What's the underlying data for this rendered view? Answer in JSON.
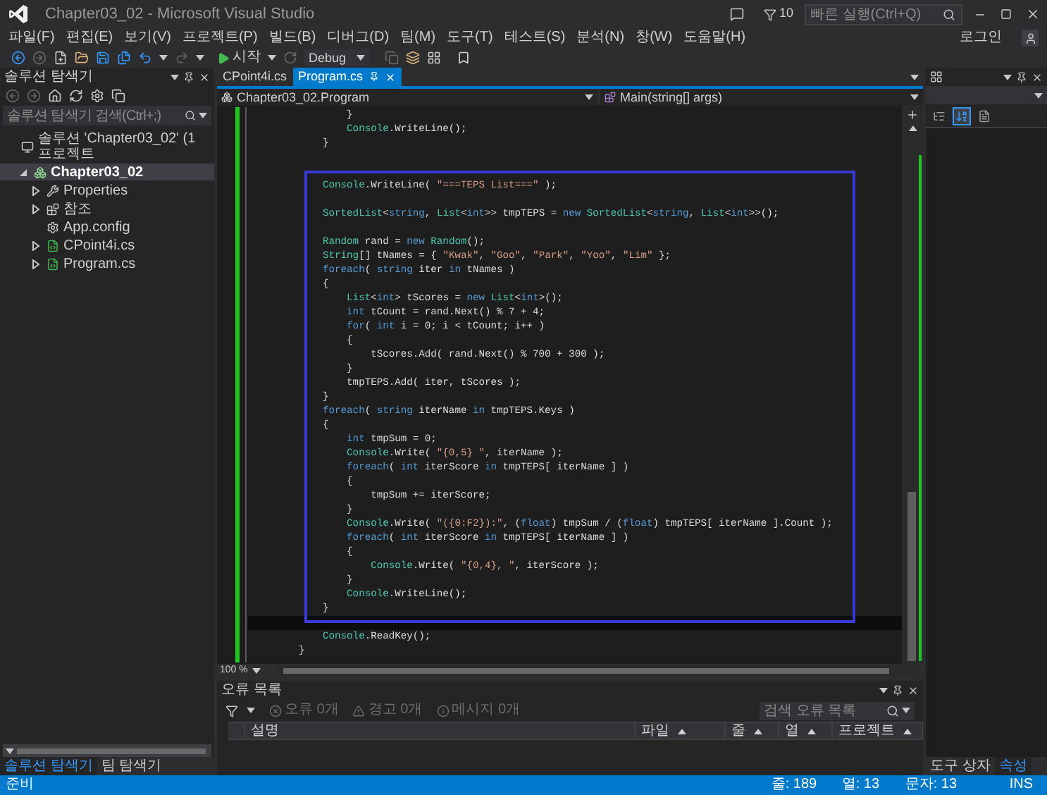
{
  "window": {
    "title": "Chapter03_02 - Microsoft Visual Studio"
  },
  "title_bar": {
    "notification_count": "10",
    "quick_launch": {
      "placeholder": "빠른 실행(Ctrl+Q)"
    }
  },
  "menu": [
    "파일(F)",
    "편집(E)",
    "보기(V)",
    "프로젝트(P)",
    "빌드(B)",
    "디버그(D)",
    "팀(M)",
    "도구(T)",
    "테스트(S)",
    "분석(N)",
    "창(W)",
    "도움말(H)"
  ],
  "account": {
    "label": "로그인"
  },
  "toolbar": {
    "start_label": "시작",
    "configuration": "Debug"
  },
  "solution_explorer": {
    "title": "솔루션 탐색기",
    "search": {
      "placeholder": "솔루션 탐색기 검색(Ctrl+;)"
    },
    "tree": [
      {
        "label": "솔루션 'Chapter03_02' (1 프로젝트",
        "kind": "solution",
        "selected": false,
        "children": [
          {
            "label": "Chapter03_02",
            "kind": "project",
            "expanded": true,
            "selected": true,
            "children": [
              {
                "label": "Properties",
                "kind": "properties",
                "expanded": false,
                "selected": false
              },
              {
                "label": "참조",
                "kind": "references",
                "expanded": false,
                "selected": false
              },
              {
                "label": "App.config",
                "kind": "config",
                "selected": false
              },
              {
                "label": "CPoint4i.cs",
                "kind": "csharp",
                "expanded": false,
                "selected": false
              },
              {
                "label": "Program.cs",
                "kind": "csharp",
                "expanded": false,
                "selected": false
              }
            ]
          }
        ]
      }
    ],
    "bottom_tabs": [
      {
        "label": "솔루션 탐색기",
        "selected": true
      },
      {
        "label": "팀 탐색기",
        "selected": false
      }
    ]
  },
  "editor": {
    "tabs": [
      {
        "label": "CPoint4i.cs",
        "selected": false
      },
      {
        "label": "Program.cs",
        "selected": true
      }
    ],
    "nav": {
      "type": "Chapter03_02.Program",
      "member": "Main(string[] args)"
    },
    "lines": [
      {
        "current": false,
        "tokens": [
          {
            "kind": "plain",
            "text": "        }"
          }
        ]
      },
      {
        "current": false,
        "tokens": [
          {
            "kind": "type",
            "text": "        Console"
          },
          {
            "kind": "plain",
            "text": ".WriteLine();"
          }
        ]
      },
      {
        "current": false,
        "tokens": [
          {
            "kind": "plain",
            "text": "    }"
          }
        ]
      },
      {
        "current": false
      },
      {
        "current": false
      },
      {
        "current": false,
        "tokens": [
          {
            "kind": "type",
            "text": "    Console"
          },
          {
            "kind": "plain",
            "text": ".WriteLine( "
          },
          {
            "kind": "string",
            "text": "\"===TEPS List===\""
          },
          {
            "kind": "plain",
            "text": " );"
          }
        ]
      },
      {
        "current": false
      },
      {
        "current": false,
        "tokens": [
          {
            "kind": "type",
            "text": "    SortedList"
          },
          {
            "kind": "plain",
            "text": "<"
          },
          {
            "kind": "keyword",
            "text": "string"
          },
          {
            "kind": "plain",
            "text": ", "
          },
          {
            "kind": "type",
            "text": "List"
          },
          {
            "kind": "plain",
            "text": "<"
          },
          {
            "kind": "keyword",
            "text": "int"
          },
          {
            "kind": "plain",
            "text": ">> tmpTEPS = "
          },
          {
            "kind": "keyword",
            "text": "new "
          },
          {
            "kind": "type",
            "text": "SortedList"
          },
          {
            "kind": "plain",
            "text": "<"
          },
          {
            "kind": "keyword",
            "text": "string"
          },
          {
            "kind": "plain",
            "text": ", "
          },
          {
            "kind": "type",
            "text": "List"
          },
          {
            "kind": "plain",
            "text": "<"
          },
          {
            "kind": "keyword",
            "text": "int"
          },
          {
            "kind": "plain",
            "text": ">>();"
          }
        ]
      },
      {
        "current": false
      },
      {
        "current": false,
        "tokens": [
          {
            "kind": "type",
            "text": "    Random"
          },
          {
            "kind": "plain",
            "text": " rand = "
          },
          {
            "kind": "keyword",
            "text": "new "
          },
          {
            "kind": "type",
            "text": "Random"
          },
          {
            "kind": "plain",
            "text": "();"
          }
        ]
      },
      {
        "current": false,
        "tokens": [
          {
            "kind": "type",
            "text": "    String"
          },
          {
            "kind": "plain",
            "text": "[] tNames = { "
          },
          {
            "kind": "string",
            "text": "\"Kwak\""
          },
          {
            "kind": "plain",
            "text": ", "
          },
          {
            "kind": "string",
            "text": "\"Goo\""
          },
          {
            "kind": "plain",
            "text": ", "
          },
          {
            "kind": "string",
            "text": "\"Park\""
          },
          {
            "kind": "plain",
            "text": ", "
          },
          {
            "kind": "string",
            "text": "\"Yoo\""
          },
          {
            "kind": "plain",
            "text": ", "
          },
          {
            "kind": "string",
            "text": "\"Lim\""
          },
          {
            "kind": "plain",
            "text": " };"
          }
        ]
      },
      {
        "current": false,
        "tokens": [
          {
            "kind": "keyword",
            "text": "    foreach"
          },
          {
            "kind": "plain",
            "text": "( "
          },
          {
            "kind": "keyword",
            "text": "string"
          },
          {
            "kind": "plain",
            "text": " iter "
          },
          {
            "kind": "keyword",
            "text": "in"
          },
          {
            "kind": "plain",
            "text": " tNames )"
          }
        ]
      },
      {
        "current": false,
        "tokens": [
          {
            "kind": "plain",
            "text": "    {"
          }
        ]
      },
      {
        "current": false,
        "tokens": [
          {
            "kind": "type",
            "text": "        List"
          },
          {
            "kind": "plain",
            "text": "<"
          },
          {
            "kind": "keyword",
            "text": "int"
          },
          {
            "kind": "plain",
            "text": "> tScores = "
          },
          {
            "kind": "keyword",
            "text": "new "
          },
          {
            "kind": "type",
            "text": "List"
          },
          {
            "kind": "plain",
            "text": "<"
          },
          {
            "kind": "keyword",
            "text": "int"
          },
          {
            "kind": "plain",
            "text": ">();"
          }
        ]
      },
      {
        "current": false,
        "tokens": [
          {
            "kind": "keyword",
            "text": "        int"
          },
          {
            "kind": "plain",
            "text": " tCount = rand.Next() % 7 + 4;"
          }
        ]
      },
      {
        "current": false,
        "tokens": [
          {
            "kind": "keyword",
            "text": "        for"
          },
          {
            "kind": "plain",
            "text": "( "
          },
          {
            "kind": "keyword",
            "text": "int"
          },
          {
            "kind": "plain",
            "text": " i = 0; i < tCount; i++ )"
          }
        ]
      },
      {
        "current": false,
        "tokens": [
          {
            "kind": "plain",
            "text": "        {"
          }
        ]
      },
      {
        "current": false,
        "tokens": [
          {
            "kind": "plain",
            "text": "            tScores.Add( rand.Next() % 700 + 300 );"
          }
        ]
      },
      {
        "current": false,
        "tokens": [
          {
            "kind": "plain",
            "text": "        }"
          }
        ]
      },
      {
        "current": false,
        "tokens": [
          {
            "kind": "plain",
            "text": "        tmpTEPS.Add( iter, tScores );"
          }
        ]
      },
      {
        "current": false,
        "tokens": [
          {
            "kind": "plain",
            "text": "    }"
          }
        ]
      },
      {
        "current": false,
        "tokens": [
          {
            "kind": "keyword",
            "text": "    foreach"
          },
          {
            "kind": "plain",
            "text": "( "
          },
          {
            "kind": "keyword",
            "text": "string"
          },
          {
            "kind": "plain",
            "text": " iterName "
          },
          {
            "kind": "keyword",
            "text": "in"
          },
          {
            "kind": "plain",
            "text": " tmpTEPS.Keys )"
          }
        ]
      },
      {
        "current": false,
        "tokens": [
          {
            "kind": "plain",
            "text": "    {"
          }
        ]
      },
      {
        "current": false,
        "tokens": [
          {
            "kind": "keyword",
            "text": "        int"
          },
          {
            "kind": "plain",
            "text": " tmpSum = 0;"
          }
        ]
      },
      {
        "current": false,
        "tokens": [
          {
            "kind": "type",
            "text": "        Console"
          },
          {
            "kind": "plain",
            "text": ".Write( "
          },
          {
            "kind": "string",
            "text": "\"{0,5} \""
          },
          {
            "kind": "plain",
            "text": ", iterName );"
          }
        ]
      },
      {
        "current": false,
        "tokens": [
          {
            "kind": "keyword",
            "text": "        foreach"
          },
          {
            "kind": "plain",
            "text": "( "
          },
          {
            "kind": "keyword",
            "text": "int"
          },
          {
            "kind": "plain",
            "text": " iterScore "
          },
          {
            "kind": "keyword",
            "text": "in"
          },
          {
            "kind": "plain",
            "text": " tmpTEPS[ iterName ] )"
          }
        ]
      },
      {
        "current": false,
        "tokens": [
          {
            "kind": "plain",
            "text": "        {"
          }
        ]
      },
      {
        "current": false,
        "tokens": [
          {
            "kind": "plain",
            "text": "            tmpSum += iterScore;"
          }
        ]
      },
      {
        "current": false,
        "tokens": [
          {
            "kind": "plain",
            "text": "        }"
          }
        ]
      },
      {
        "current": false,
        "tokens": [
          {
            "kind": "type",
            "text": "        Console"
          },
          {
            "kind": "plain",
            "text": ".Write( "
          },
          {
            "kind": "string",
            "text": "\"({0:F2}):\""
          },
          {
            "kind": "plain",
            "text": ", ("
          },
          {
            "kind": "keyword",
            "text": "float"
          },
          {
            "kind": "plain",
            "text": ") tmpSum / ("
          },
          {
            "kind": "keyword",
            "text": "float"
          },
          {
            "kind": "plain",
            "text": ") tmpTEPS[ iterName ].Count );"
          }
        ]
      },
      {
        "current": false,
        "tokens": [
          {
            "kind": "keyword",
            "text": "        foreach"
          },
          {
            "kind": "plain",
            "text": "( "
          },
          {
            "kind": "keyword",
            "text": "int"
          },
          {
            "kind": "plain",
            "text": " iterScore "
          },
          {
            "kind": "keyword",
            "text": "in"
          },
          {
            "kind": "plain",
            "text": " tmpTEPS[ iterName ] )"
          }
        ]
      },
      {
        "current": false,
        "tokens": [
          {
            "kind": "plain",
            "text": "        {"
          }
        ]
      },
      {
        "current": false,
        "tokens": [
          {
            "kind": "type",
            "text": "            Console"
          },
          {
            "kind": "plain",
            "text": ".Write( "
          },
          {
            "kind": "string",
            "text": "\"{0,4}, \""
          },
          {
            "kind": "plain",
            "text": ", iterScore );"
          }
        ]
      },
      {
        "current": false,
        "tokens": [
          {
            "kind": "plain",
            "text": "        }"
          }
        ]
      },
      {
        "current": false,
        "tokens": [
          {
            "kind": "type",
            "text": "        Console"
          },
          {
            "kind": "plain",
            "text": ".WriteLine();"
          }
        ]
      },
      {
        "current": false,
        "tokens": [
          {
            "kind": "plain",
            "text": "    }"
          }
        ]
      },
      {
        "current": true
      },
      {
        "current": false,
        "tokens": [
          {
            "kind": "type",
            "text": "    Console"
          },
          {
            "kind": "plain",
            "text": ".ReadKey();"
          }
        ]
      },
      {
        "current": false,
        "tokens": [
          {
            "kind": "plain",
            "text": "}"
          }
        ]
      }
    ],
    "zoom": "100 %"
  },
  "error_list": {
    "title": "오류 목록",
    "filters": [
      {
        "kind": "error",
        "label": "오류 0개"
      },
      {
        "kind": "warning",
        "label": "경고 0개"
      },
      {
        "kind": "message",
        "label": "메시지 0개"
      }
    ],
    "search": {
      "placeholder": "검색 오류 목록"
    },
    "columns": [
      {
        "label": "설명",
        "sortable": false
      },
      {
        "label": "파일",
        "sortable": true
      },
      {
        "label": "줄",
        "sortable": true
      },
      {
        "label": "열",
        "sortable": true
      },
      {
        "label": "프로젝트",
        "sortable": true
      }
    ]
  },
  "properties": {
    "view_buttons": [
      {
        "kind": "categorized",
        "selected": false
      },
      {
        "kind": "alphabetical",
        "selected": true
      },
      {
        "kind": "pages",
        "selected": false
      }
    ],
    "bottom_tabs": [
      {
        "label": "도구 상자",
        "selected": false
      },
      {
        "label": "속성",
        "selected": true
      }
    ]
  },
  "status_bar": {
    "message": "준비",
    "line": "줄: 189",
    "column": "열: 13",
    "character": "문자: 13",
    "mode": "INS"
  }
}
